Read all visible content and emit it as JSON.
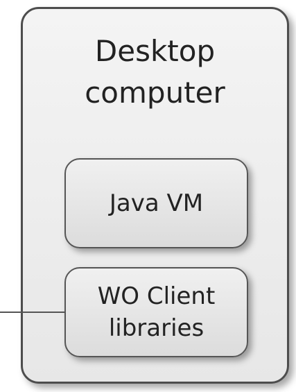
{
  "diagram": {
    "container": {
      "title": "Desktop\ncomputer"
    },
    "boxes": [
      {
        "label": "Java VM"
      },
      {
        "label": "WO Client\nlibraries"
      }
    ]
  }
}
